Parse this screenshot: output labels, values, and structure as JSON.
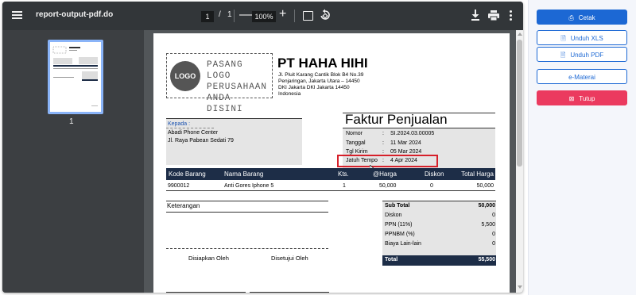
{
  "viewer": {
    "title": "report-output-pdf.do",
    "page_current": "1",
    "page_separator": "/",
    "page_total": "1",
    "zoom": "100%",
    "minus": "—",
    "plus": "+",
    "thumbnail_page_label": "1"
  },
  "document": {
    "logo_circle_text": "LOGO",
    "logo_placeholder_lines": [
      "PASANG LOGO",
      "PERUSAHAAN",
      "ANDA DISINI"
    ],
    "company_name": "PT HAHA HIHI",
    "company_address": [
      "Jl. Pluit Karang Cantik Blok B4 No.39",
      "Penjaringan, Jakarta Utara – 14450",
      "DKI Jakarta DKI Jakarta 14450",
      "Indonesia"
    ],
    "kepada_label": "Kepada :",
    "customer_name": "Abadi Phone Center",
    "customer_address": "Jl. Raya Pabean Sedati 79",
    "invoice_title": "Faktur Penjualan",
    "invoice_fields": [
      {
        "label": "Nomor",
        "value": "SI.2024.03.00005"
      },
      {
        "label": "Tanggal",
        "value": "11 Mar 2024"
      },
      {
        "label": "Tgl Kirim",
        "value": "05 Mar 2024"
      },
      {
        "label": "Jatuh Tempo",
        "value": "4 Apr 2024"
      }
    ],
    "colon": ":",
    "table_headers": {
      "kode": "Kode Barang",
      "nama": "Nama Barang",
      "kts": "Kts.",
      "harga": "@Harga",
      "diskon": "Diskon",
      "total": "Total Harga"
    },
    "table_rows": [
      {
        "kode": "9900012",
        "nama": "Anti Gores Iphone 5",
        "kts": "1",
        "harga": "50,000",
        "diskon": "0",
        "total": "50,000"
      }
    ],
    "keterangan_label": "Keterangan",
    "summary": [
      {
        "label": "Sub Total",
        "value": "50,000"
      },
      {
        "label": "Diskon",
        "value": "0"
      },
      {
        "label": "PPN (11%)",
        "value": "5,500"
      },
      {
        "label": "PPNBM (%)",
        "value": "0"
      },
      {
        "label": "Biaya Lain-lain",
        "value": "0"
      }
    ],
    "summary_total": {
      "label": "Total",
      "value": "55,500"
    },
    "sign_prepared": "Disiapkan Oleh",
    "sign_approved": "Disetujui Oleh"
  },
  "actions": {
    "cetak": "Cetak",
    "unduh_xls": "Unduh XLS",
    "unduh_pdf": "Unduh PDF",
    "e_materai": "e-Materai",
    "tutup": "Tutup"
  },
  "colors": {
    "primary": "#1c68d4",
    "danger": "#eb3a5f",
    "table_header": "#1d2d47",
    "highlight": "#d6202a",
    "toolbar": "#323639"
  },
  "icons": [
    "menu-icon",
    "fit-page-icon",
    "rotate-icon",
    "download-icon",
    "print-icon",
    "more-icon",
    "file-icon",
    "close-icon"
  ]
}
